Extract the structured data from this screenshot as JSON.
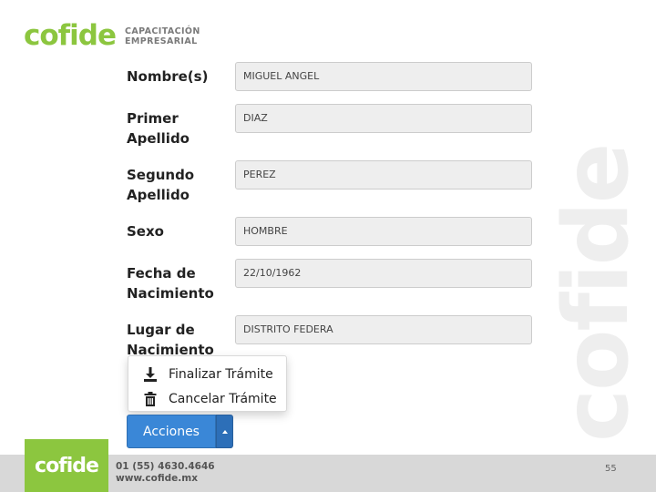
{
  "header": {
    "logo_text": "cofide",
    "logo_tag_line1": "CAPACITACIÓN",
    "logo_tag_line2": "EMPRESARIAL"
  },
  "watermark_text": "cofide",
  "form": {
    "fields": [
      {
        "label": "Nombre(s)",
        "value": "MIGUEL ANGEL"
      },
      {
        "label": "Primer Apellido",
        "value": "DIAZ"
      },
      {
        "label": "Segundo Apellido",
        "value": "PEREZ"
      },
      {
        "label": "Sexo",
        "value": "HOMBRE"
      },
      {
        "label": "Fecha de Nacimiento",
        "value": "22/10/1962"
      },
      {
        "label": "Lugar de Nacimiento",
        "value": "DISTRITO FEDERA"
      }
    ]
  },
  "actions_menu": {
    "items": [
      {
        "label": "Finalizar Trámite",
        "icon": "download-icon"
      },
      {
        "label": "Cancelar Trámite",
        "icon": "trash-icon"
      }
    ],
    "button_label": "Acciones"
  },
  "footer": {
    "logo_text": "cofide",
    "phone": "01 (55) 4630.4646",
    "website": "www.cofide.mx",
    "page_number": "55"
  },
  "colors": {
    "brand_green": "#8cc63f",
    "button_blue": "#3a87d7",
    "footer_gray": "#d8d8d8"
  }
}
